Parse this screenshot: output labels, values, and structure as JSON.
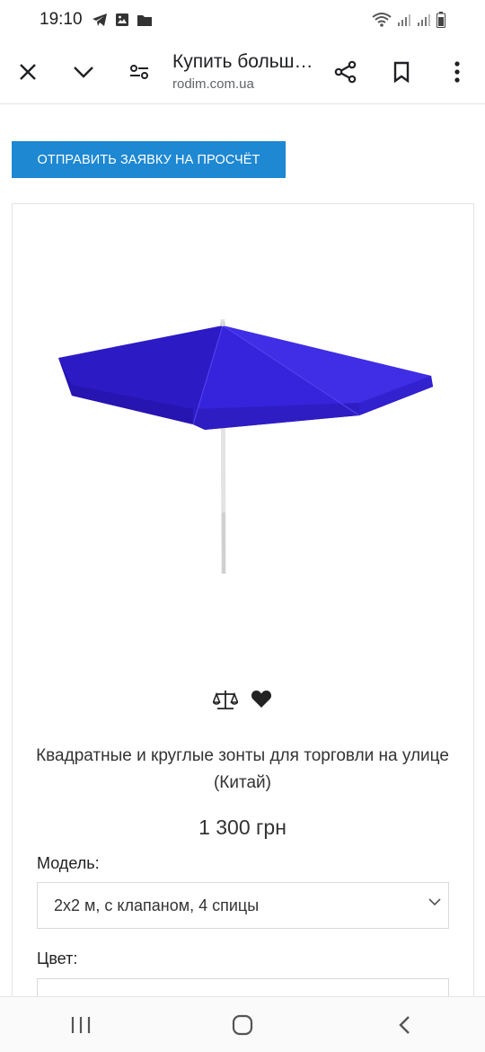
{
  "status_bar": {
    "time": "19:10"
  },
  "toolbar": {
    "title": "Купить большо...",
    "url": "rodim.com.ua"
  },
  "cta": {
    "label": "ОТПРАВИТЬ ЗАЯВКУ НА ПРОСЧЁТ"
  },
  "product": {
    "title": "Квадратные и круглые зонты для торговли на улице (Китай)",
    "price": "1 300 грн",
    "canopy_color": "#3421d6"
  },
  "options": {
    "model_label": "Модель:",
    "model_value": "2х2 м, с клапаном, 4 спицы",
    "color_label": "Цвет:"
  },
  "icons": {
    "close": "close-icon",
    "chevron_down": "chevron-down-icon",
    "settings": "site-settings-icon",
    "share": "share-icon",
    "bookmark": "bookmark-icon",
    "menu": "more-vert-icon",
    "compare": "scales-icon",
    "wishlist": "heart-icon"
  },
  "colors": {
    "accent": "#1e88d2"
  }
}
